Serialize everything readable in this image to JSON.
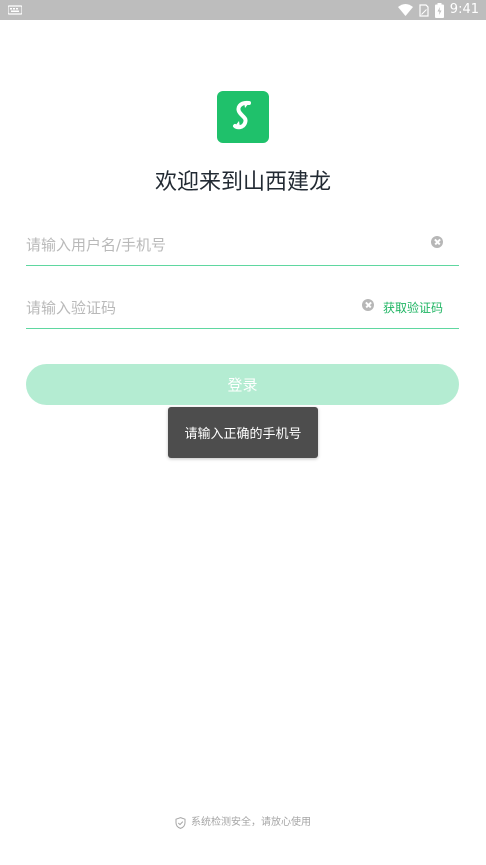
{
  "status_bar": {
    "time": "9:41",
    "icons": [
      "notification-icon",
      "wifi-icon",
      "sim-icon",
      "battery-icon"
    ]
  },
  "app": {
    "logo_icon": "app-logo-icon",
    "welcome_title": "欢迎来到山西建龙"
  },
  "form": {
    "username": {
      "value": "",
      "placeholder": "请输入用户名/手机号"
    },
    "code": {
      "value": "",
      "placeholder": "请输入验证码"
    },
    "get_code_label": "获取验证码",
    "login_label": "登录"
  },
  "toast": {
    "message": "请输入正确的手机号"
  },
  "footer": {
    "icon": "shield-check-icon",
    "text": "系统检测安全，请放心使用"
  },
  "colors": {
    "accent": "#1fc16b",
    "login_button_disabled": "#b4ecd2",
    "input_underline": "#5fd7a0",
    "toast_bg": "#4d4d4d"
  }
}
